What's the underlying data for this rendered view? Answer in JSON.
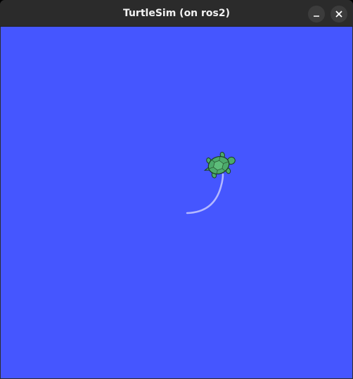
{
  "window": {
    "title": "TurtleSim (on ros2)"
  },
  "titlebar_buttons": [
    {
      "name": "minimize",
      "icon": "minimize-icon"
    },
    {
      "name": "close",
      "icon": "close-icon"
    }
  ],
  "canvas": {
    "background_color": "#4556ff",
    "pen_color": "#b3b8ff",
    "turtle_color": "#4caa6b"
  }
}
